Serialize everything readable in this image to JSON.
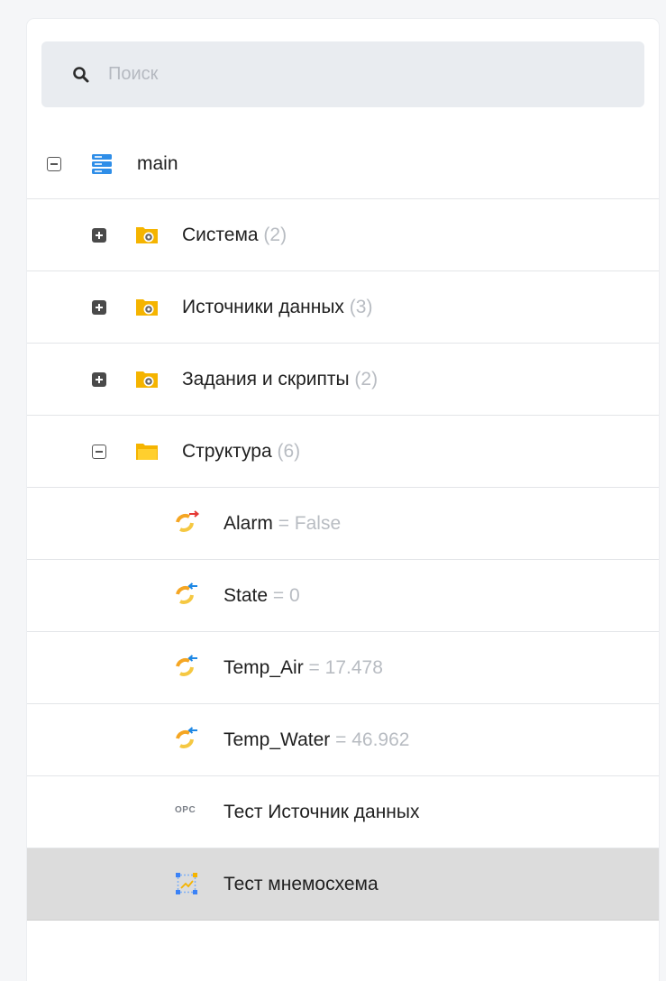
{
  "search": {
    "placeholder": "Поиск",
    "value": ""
  },
  "tree": {
    "root": {
      "label": "main"
    },
    "folders": [
      {
        "label": "Система",
        "count": "(2)"
      },
      {
        "label": "Источники данных",
        "count": "(3)"
      },
      {
        "label": "Задания и скрипты",
        "count": "(2)"
      },
      {
        "label": "Структура",
        "count": "(6)"
      }
    ],
    "items": [
      {
        "label": "Alarm",
        "value": "= False"
      },
      {
        "label": "State",
        "value": "= 0"
      },
      {
        "label": "Temp_Air",
        "value": "= 17.478"
      },
      {
        "label": "Temp_Water",
        "value": "= 46.962"
      },
      {
        "label": "Тест Источник данных",
        "icon_text": "OPC"
      },
      {
        "label": "Тест мнемосхема"
      }
    ]
  },
  "colors": {
    "folder": "#f5b400",
    "server": "#2f8ee8",
    "arrow_out": "#e53935",
    "arrow_in": "#1e88e5",
    "selected_row": "#dcdcdc",
    "muted_text": "#b8bcc2"
  }
}
